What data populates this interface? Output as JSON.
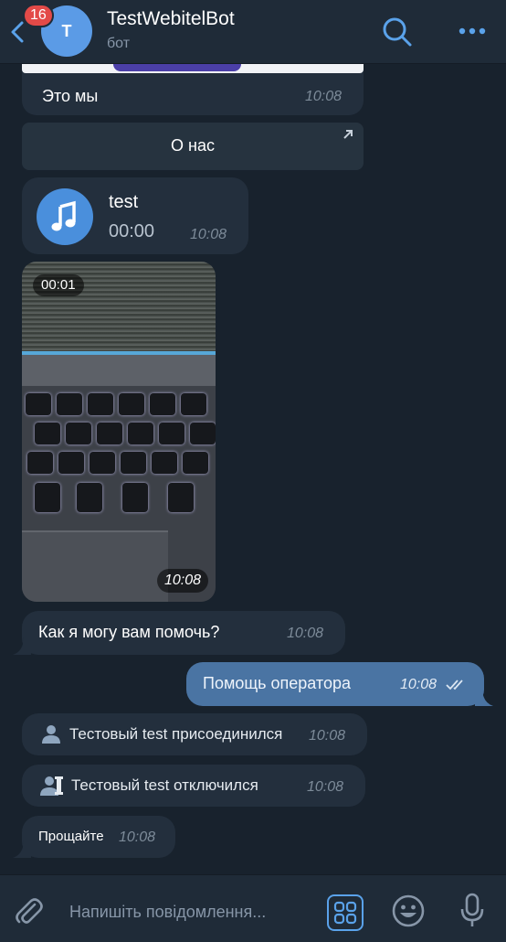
{
  "header": {
    "unread_badge": "16",
    "avatar_letter": "T",
    "title": "TestWebitelBot",
    "subtitle": "бот"
  },
  "messages": {
    "card_caption": "Это мы",
    "card_time": "10:08",
    "inline_button_label": "О нас",
    "audio_title": "test",
    "audio_duration": "00:00",
    "audio_time": "10:08",
    "video_duration": "00:01",
    "video_time": "10:08",
    "question_text": "Как я могу вам помочь?",
    "question_time": "10:08",
    "outgoing_text": "Помощь оператора",
    "outgoing_time": "10:08",
    "joined_text": "Тестовый test присоединился",
    "joined_time": "10:08",
    "left_text": "Тестовый test отключился",
    "left_time": "10:08",
    "goodbye_text": "Прощайте",
    "goodbye_time": "10:08"
  },
  "input": {
    "placeholder": "Напишіть повідомлення..."
  },
  "colors": {
    "background": "#18222d",
    "header": "#1f2b38",
    "incoming_bubble": "#232f3d",
    "outgoing_bubble": "#4a74a3",
    "accent": "#5aa2ea",
    "badge": "#e34a48"
  },
  "icons": [
    "back-arrow-icon",
    "search-icon",
    "more-dots-icon",
    "external-link-icon",
    "music-note-icon",
    "read-checkmarks-icon",
    "user-icon",
    "user-left-icon",
    "paperclip-icon",
    "bot-menu-icon",
    "emoji-icon",
    "microphone-icon"
  ]
}
